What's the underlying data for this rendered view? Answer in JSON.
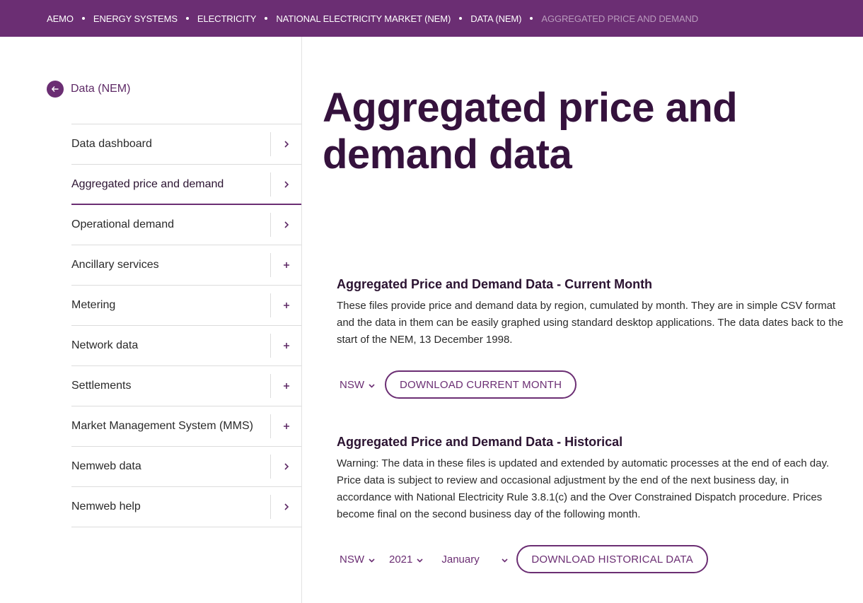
{
  "breadcrumb": {
    "items": [
      "AEMO",
      "ENERGY SYSTEMS",
      "ELECTRICITY",
      "NATIONAL ELECTRICITY MARKET (NEM)",
      "DATA (NEM)"
    ],
    "current": "AGGREGATED PRICE AND DEMAND"
  },
  "sidebar": {
    "back_label": "Data (NEM)",
    "items": [
      {
        "label": "Data dashboard",
        "toggle": "chevron"
      },
      {
        "label": "Aggregated price and demand",
        "toggle": "chevron"
      },
      {
        "label": "Operational demand",
        "toggle": "chevron"
      },
      {
        "label": "Ancillary services",
        "toggle": "plus"
      },
      {
        "label": "Metering",
        "toggle": "plus"
      },
      {
        "label": "Network data",
        "toggle": "plus"
      },
      {
        "label": "Settlements",
        "toggle": "plus"
      },
      {
        "label": "Market Management System (MMS)",
        "toggle": "plus"
      },
      {
        "label": "Nemweb data",
        "toggle": "chevron"
      },
      {
        "label": "Nemweb help",
        "toggle": "chevron"
      }
    ],
    "active_index": 1
  },
  "main": {
    "title": "Aggregated price and demand data",
    "current_month": {
      "heading": "Aggregated Price and Demand Data - Current Month",
      "body": "These files provide price and demand data by region, cumulated by month. They are in simple CSV format and the data in them can be easily graphed using standard desktop applications. The data dates back to the start of the NEM, 13 December 1998.",
      "region_select": "NSW",
      "download_label": "DOWNLOAD CURRENT MONTH"
    },
    "historical": {
      "heading": "Aggregated Price and Demand Data - Historical",
      "body": "Warning: The data in these files is updated and extended by automatic processes at the end of each day. Price data is subject to review and occasional adjustment by the end of the next business day, in accordance with National Electricity Rule 3.8.1(c) and the Over Constrained Dispatch procedure. Prices become final on the second business day of the following month.",
      "region_select": "NSW",
      "year_select": "2021",
      "month_select": "January",
      "download_label": "DOWNLOAD HISTORICAL DATA"
    }
  },
  "colors": {
    "brand": "#6b2e73",
    "title": "#35123d",
    "current_crumb": "#b99bbd"
  },
  "icons": {
    "back": "arrow-left-icon",
    "chevron": "chevron-right-icon",
    "plus": "plus-icon",
    "dropdown": "chevron-down-icon"
  }
}
